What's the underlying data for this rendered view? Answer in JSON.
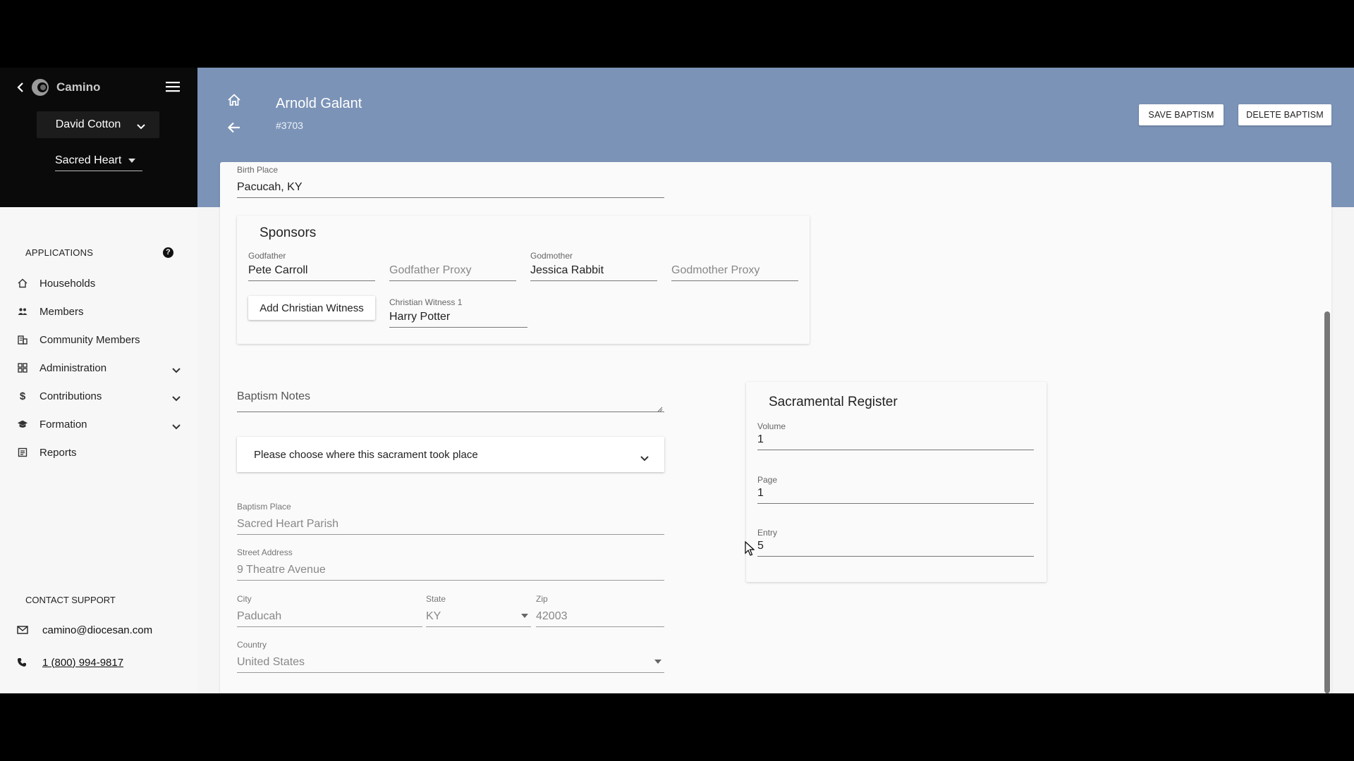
{
  "app": {
    "name": "Camino",
    "user": "David Cotton",
    "parish": "Sacred Heart"
  },
  "sidebar": {
    "applications_label": "APPLICATIONS",
    "items": [
      {
        "label": "Households",
        "icon": "home-icon"
      },
      {
        "label": "Members",
        "icon": "people-icon"
      },
      {
        "label": "Community Members",
        "icon": "building-icon"
      },
      {
        "label": "Administration",
        "icon": "dashboard-icon",
        "expandable": true
      },
      {
        "label": "Contributions",
        "icon": "dollar-icon",
        "expandable": true
      },
      {
        "label": "Formation",
        "icon": "graduation-cap-icon",
        "expandable": true
      },
      {
        "label": "Reports",
        "icon": "report-icon"
      }
    ],
    "support_label": "CONTACT SUPPORT",
    "support_email": "camino@diocesan.com",
    "support_phone": "1 (800) 994-9817"
  },
  "header": {
    "name": "Arnold Galant",
    "record_id": "#3703",
    "save_label": "SAVE BAPTISM",
    "delete_label": "DELETE BAPTISM"
  },
  "form": {
    "birth_place": {
      "label": "Birth Place",
      "value": "Pacucah, KY"
    },
    "sponsors": {
      "title": "Sponsors",
      "godfather": {
        "label": "Godfather",
        "value": "Pete Carroll"
      },
      "godfather_proxy": {
        "placeholder": "Godfather Proxy"
      },
      "godmother": {
        "label": "Godmother",
        "value": "Jessica Rabbit"
      },
      "godmother_proxy": {
        "placeholder": "Godmother Proxy"
      },
      "add_witness_label": "Add Christian Witness",
      "witness_1": {
        "label": "Christian Witness 1",
        "value": "Harry Potter"
      }
    },
    "notes_placeholder": "Baptism Notes",
    "location_prompt": "Please choose where this sacrament took place",
    "baptism_place": {
      "label": "Baptism Place",
      "value": "Sacred Heart Parish"
    },
    "street_address": {
      "label": "Street Address",
      "value": "9 Theatre Avenue"
    },
    "city": {
      "label": "City",
      "value": "Paducah"
    },
    "state": {
      "label": "State",
      "value": "KY"
    },
    "zip": {
      "label": "Zip",
      "value": "42003"
    },
    "country": {
      "label": "Country",
      "value": "United States"
    }
  },
  "register": {
    "title": "Sacramental Register",
    "volume": {
      "label": "Volume",
      "value": "1"
    },
    "page": {
      "label": "Page",
      "value": "1"
    },
    "entry": {
      "label": "Entry",
      "value": "5"
    }
  }
}
